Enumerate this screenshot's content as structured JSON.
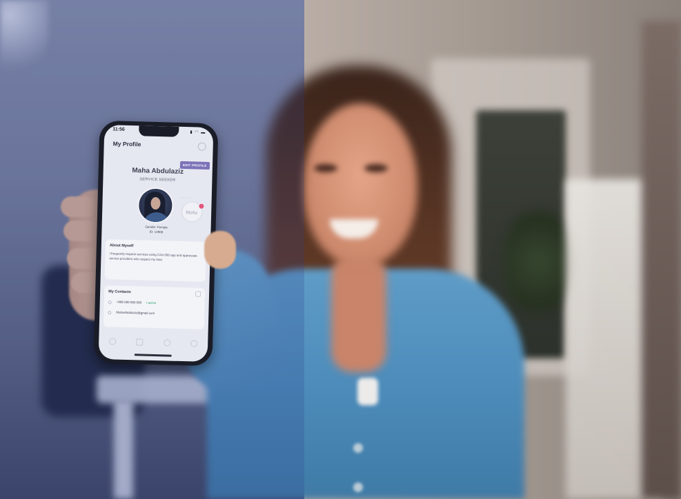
{
  "phone_screen": {
    "status": {
      "time": "11:56",
      "icons": "▮ ◠ ▬"
    },
    "header": {
      "title": "My Profile"
    },
    "edit_button": "EDIT PROFILE",
    "profile": {
      "name": "Maha Abdulaziz",
      "role": "SERVICE SEEKER",
      "gender": "Gender: Female",
      "id": "ID: 12908"
    },
    "badge": {
      "label": "....................",
      "signature": "Maha"
    },
    "about": {
      "title": "About Myself",
      "text": "I frequently request services using CAA 000 app and appreciate service providers who respect my time."
    },
    "contacts": {
      "title": "My Contacts",
      "phone": "+966 000 000 000",
      "phone_status": "• active",
      "email": "MahaAbdulaziz@gmail.com"
    }
  },
  "colors": {
    "accent": "#7b72b8",
    "active_status": "#27a067",
    "shirt": "#4d8cbb"
  }
}
